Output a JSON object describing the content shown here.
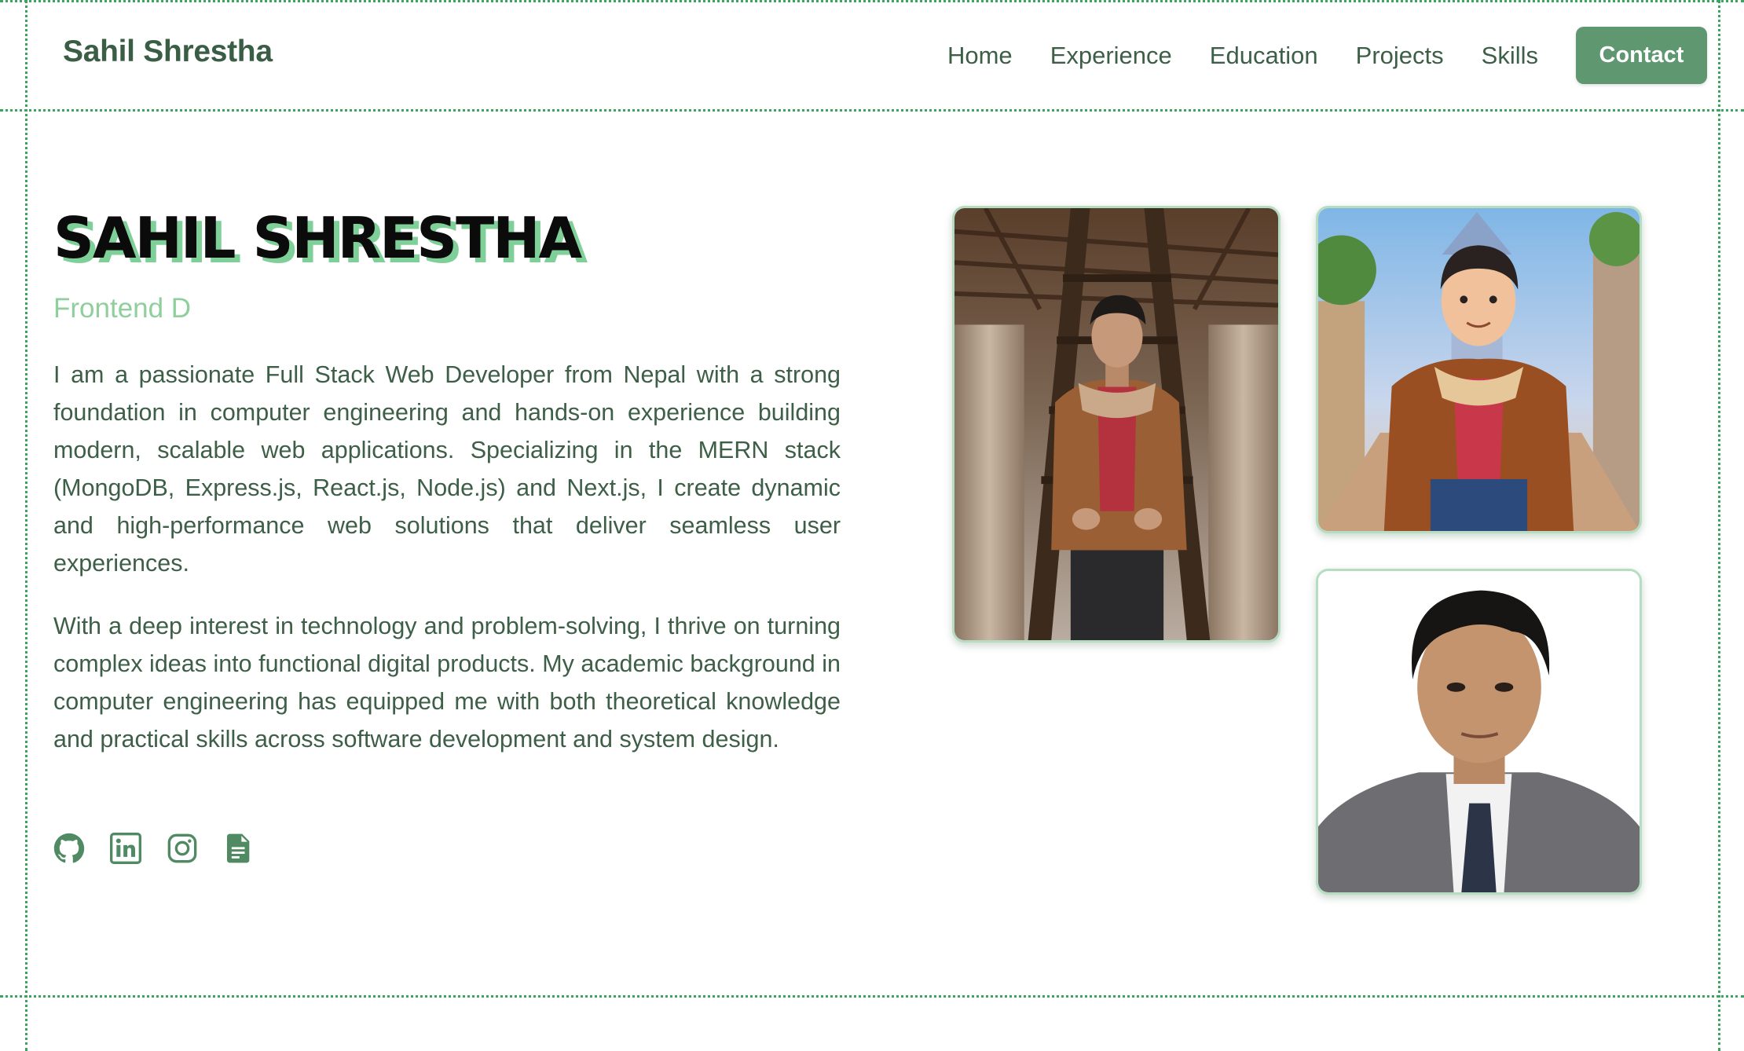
{
  "header": {
    "brand": "Sahil Shrestha",
    "nav": [
      {
        "label": "Home"
      },
      {
        "label": "Experience"
      },
      {
        "label": "Education"
      },
      {
        "label": "Projects"
      },
      {
        "label": "Skills"
      }
    ],
    "contact_label": "Contact"
  },
  "hero": {
    "title": "SAHIL SHRESTHA",
    "role": "Frontend D",
    "bio": [
      "I am a passionate Full Stack Web Developer from Nepal with a strong foundation in computer engineering and hands-on experience building modern, scalable web applications. Specializing in the MERN stack (MongoDB, Express.js, React.js, Node.js) and Next.js, I create dynamic and high-performance web solutions that deliver seamless user experiences.",
      "With a deep interest in technology and problem-solving, I thrive on turning complex ideas into functional digital products. My academic background in computer engineering has equipped me with both theoretical knowledge and practical skills across software development and system design."
    ],
    "socials": [
      {
        "icon": "github-icon"
      },
      {
        "icon": "linkedin-icon"
      },
      {
        "icon": "instagram-icon"
      },
      {
        "icon": "resume-document-icon"
      }
    ]
  },
  "photos": [
    {
      "name": "profile-photo-temple"
    },
    {
      "name": "profile-photo-cartoon"
    },
    {
      "name": "profile-photo-formal"
    }
  ],
  "colors": {
    "accent": "#5e9770",
    "text": "#3e5f47",
    "role": "#8fcf9c",
    "title_shadow": "#7fcf98",
    "frame": "#3aa55c"
  }
}
